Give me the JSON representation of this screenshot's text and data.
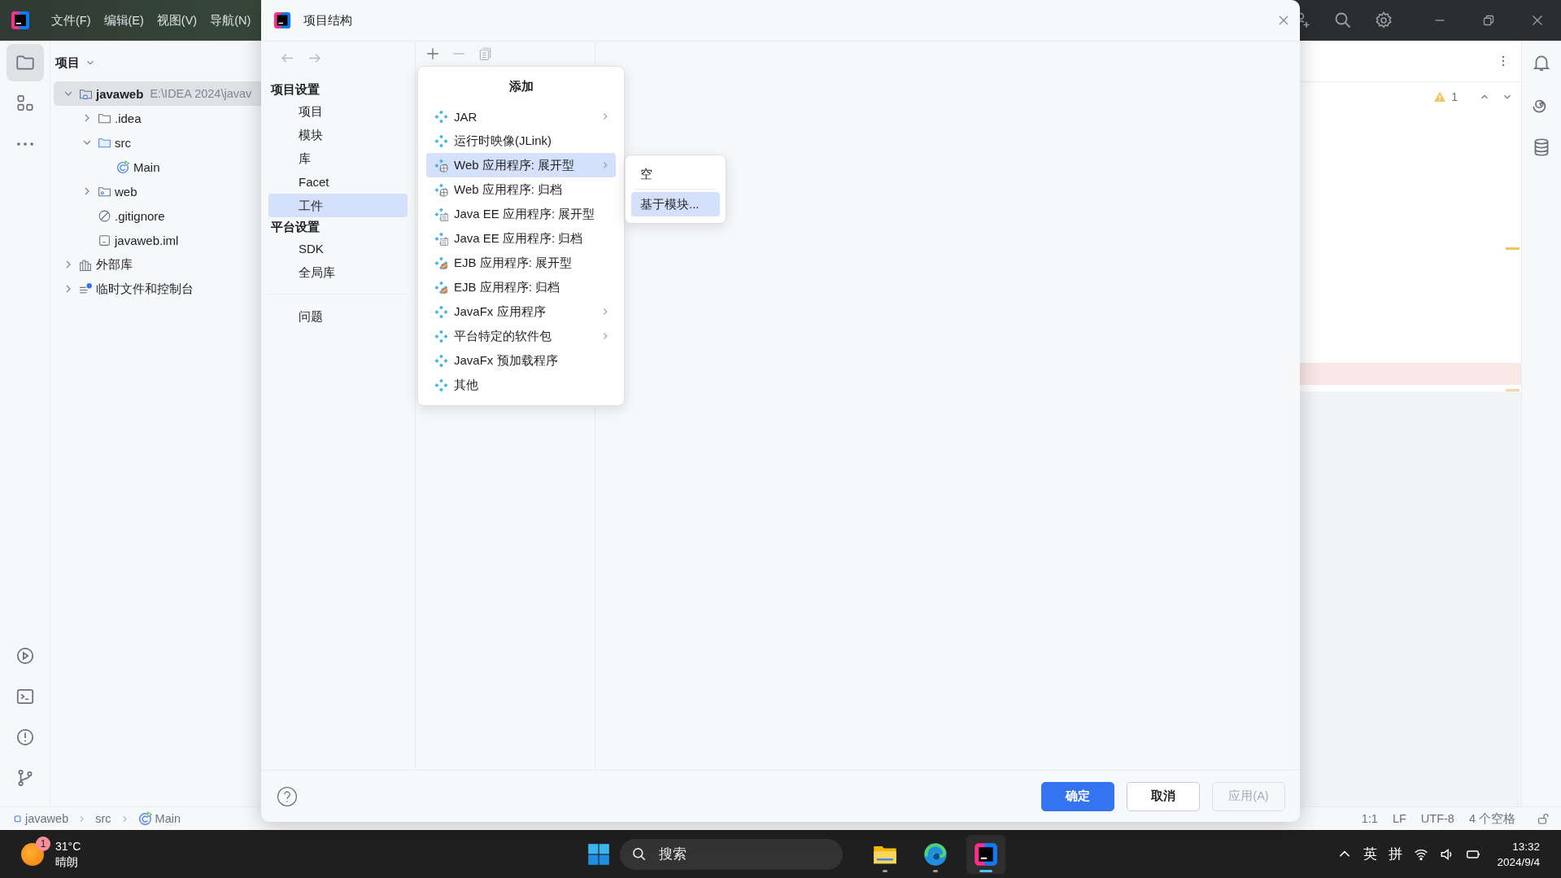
{
  "ide": {
    "menu": [
      "文件(F)",
      "编辑(E)",
      "视图(V)",
      "导航(N)"
    ],
    "tool_windows": [
      {
        "kind": "project",
        "selected": true
      },
      {
        "kind": "structure",
        "selected": false
      },
      {
        "kind": "more",
        "selected": false
      }
    ],
    "bottom_tools": [
      {
        "kind": "run"
      },
      {
        "kind": "terminal"
      },
      {
        "kind": "problems"
      },
      {
        "kind": "git"
      }
    ],
    "project_panel": {
      "title": "项目",
      "tree": [
        {
          "label": "javaweb",
          "path": "E:\\IDEA 2024\\javav",
          "kind": "module",
          "expanded": true,
          "selected": true,
          "children": [
            {
              "label": ".idea",
              "kind": "folder",
              "expanded": false,
              "selected": false
            },
            {
              "label": "src",
              "kind": "source-folder",
              "expanded": true,
              "selected": false,
              "children": [
                {
                  "label": "Main",
                  "kind": "class",
                  "selected": false
                }
              ]
            },
            {
              "label": "web",
              "kind": "web-folder",
              "expanded": false,
              "selected": false
            },
            {
              "label": ".gitignore",
              "kind": "ignore-file",
              "selected": false
            },
            {
              "label": "javaweb.iml",
              "kind": "iml-file",
              "selected": false
            }
          ]
        },
        {
          "label": "外部库",
          "kind": "libraries",
          "expanded": false,
          "selected": false
        },
        {
          "label": "临时文件和控制台",
          "kind": "scratches",
          "expanded": false,
          "selected": false
        }
      ]
    },
    "editor": {
      "warning_count": "1"
    },
    "right_tools": [
      {
        "kind": "notifications"
      },
      {
        "kind": "ai"
      },
      {
        "kind": "database"
      }
    ],
    "breadcrumbs": [
      {
        "label": "javaweb",
        "kind": "module"
      },
      {
        "label": "src",
        "kind": "folder"
      },
      {
        "label": "Main",
        "kind": "class"
      }
    ],
    "status_items": [
      "1:1",
      "LF",
      "UTF-8",
      "4 个空格"
    ]
  },
  "dialog": {
    "title": "项目结构",
    "nav": [
      {
        "kind": "header",
        "label": "项目设置"
      },
      {
        "kind": "item",
        "label": "项目",
        "selected": false
      },
      {
        "kind": "item",
        "label": "模块",
        "selected": false
      },
      {
        "kind": "item",
        "label": "库",
        "selected": false
      },
      {
        "kind": "item",
        "label": "Facet",
        "selected": false
      },
      {
        "kind": "item",
        "label": "工件",
        "selected": true
      },
      {
        "kind": "header",
        "label": "平台设置"
      },
      {
        "kind": "item",
        "label": "SDK",
        "selected": false
      },
      {
        "kind": "item",
        "label": "全局库",
        "selected": false
      },
      {
        "kind": "separator"
      },
      {
        "kind": "item",
        "label": "问题",
        "selected": false
      }
    ],
    "add_menu": {
      "title": "添加",
      "items": [
        {
          "label": "JAR",
          "kind": "artifact",
          "submenu": true,
          "selected": false
        },
        {
          "label": "运行时映像(JLink)",
          "kind": "artifact",
          "submenu": false,
          "selected": false
        },
        {
          "label": "Web 应用程序: 展开型",
          "kind": "web",
          "submenu": true,
          "selected": true
        },
        {
          "label": "Web 应用程序: 归档",
          "kind": "web",
          "submenu": false,
          "selected": false
        },
        {
          "label": "Java EE 应用程序: 展开型",
          "kind": "javaee",
          "submenu": false,
          "selected": false
        },
        {
          "label": "Java EE 应用程序: 归档",
          "kind": "javaee",
          "submenu": false,
          "selected": false
        },
        {
          "label": "EJB 应用程序: 展开型",
          "kind": "ejb",
          "submenu": false,
          "selected": false
        },
        {
          "label": "EJB 应用程序: 归档",
          "kind": "ejb",
          "submenu": false,
          "selected": false
        },
        {
          "label": "JavaFx 应用程序",
          "kind": "artifact",
          "submenu": true,
          "selected": false
        },
        {
          "label": "平台特定的软件包",
          "kind": "artifact",
          "submenu": true,
          "selected": false
        },
        {
          "label": "JavaFx 预加载程序",
          "kind": "artifact",
          "submenu": false,
          "selected": false
        },
        {
          "label": "其他",
          "kind": "artifact",
          "submenu": false,
          "selected": false
        }
      ]
    },
    "submenu": {
      "items": [
        {
          "label": "空",
          "selected": false
        },
        {
          "label": "基于模块...",
          "selected": true
        }
      ]
    },
    "buttons": [
      {
        "label": "确定",
        "kind": "primary",
        "disabled": false
      },
      {
        "label": "取消",
        "kind": "normal",
        "disabled": false
      },
      {
        "label": "应用(A)",
        "kind": "normal",
        "disabled": true
      }
    ]
  },
  "taskbar": {
    "weather": {
      "badge": "1",
      "temperature": "31°C",
      "condition": "晴朗"
    },
    "search": {
      "placeholder": "搜索"
    },
    "apps": [
      {
        "kind": "files",
        "active": false
      },
      {
        "kind": "browser",
        "active": false
      },
      {
        "kind": "ide",
        "active": true
      }
    ],
    "tray": {
      "input_mode": "英",
      "ime": "拼",
      "time": "13:32",
      "date": "2024/9/4"
    }
  }
}
